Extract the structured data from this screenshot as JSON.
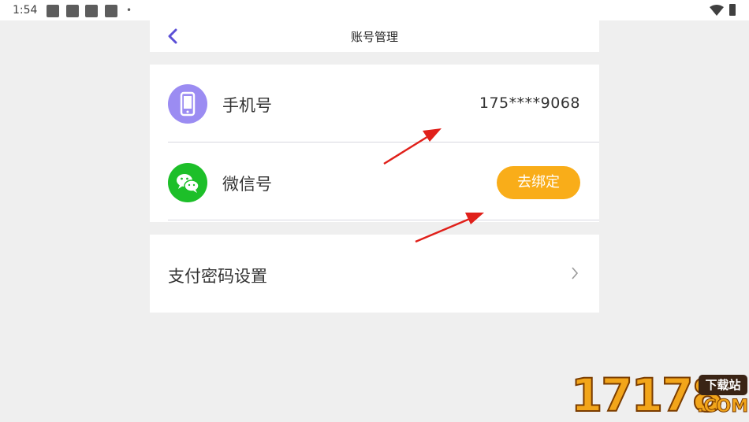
{
  "status_bar": {
    "time": "1:54",
    "dot": "•"
  },
  "header": {
    "title": "账号管理",
    "back_icon": "chevron-left-icon"
  },
  "accounts": [
    {
      "label": "手机号",
      "icon": "smartphone-icon",
      "icon_bg": "#9b8cf2",
      "value": "175****9068"
    },
    {
      "label": "微信号",
      "icon": "wechat-icon",
      "icon_bg": "#1dbf29",
      "action": "去绑定"
    }
  ],
  "payment": {
    "label": "支付密码设置",
    "icon": "chevron-right-icon"
  },
  "watermark": {
    "number": "17178",
    "badge": "下载站",
    "suffix": ".COM"
  },
  "colors": {
    "accent_purple": "#6a5ae0",
    "button_orange": "#f9ad19",
    "annotation_arrow": "#e0201a"
  }
}
